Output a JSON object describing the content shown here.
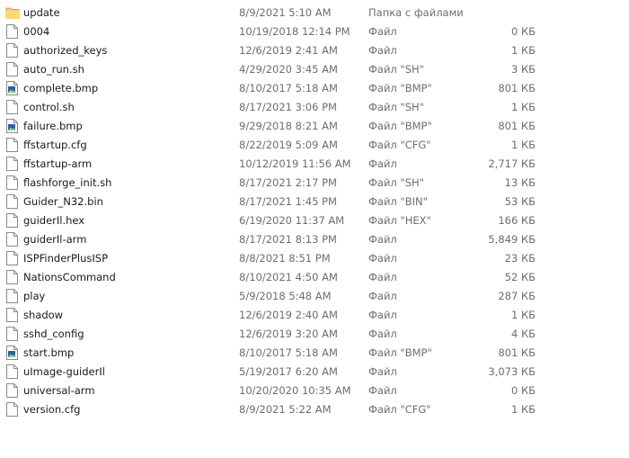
{
  "files": [
    {
      "name": "update",
      "date": "8/9/2021 5:10 AM",
      "type": "Папка с файлами",
      "size": "",
      "icon": "folder-icon"
    },
    {
      "name": "0004",
      "date": "10/19/2018 12:14 PM",
      "type": "Файл",
      "size": "0 КБ",
      "icon": "file-icon"
    },
    {
      "name": "authorized_keys",
      "date": "12/6/2019 2:41 AM",
      "type": "Файл",
      "size": "1 КБ",
      "icon": "file-icon"
    },
    {
      "name": "auto_run.sh",
      "date": "4/29/2020 3:45 AM",
      "type": "Файл \"SH\"",
      "size": "3 КБ",
      "icon": "file-icon"
    },
    {
      "name": "complete.bmp",
      "date": "8/10/2017 5:18 AM",
      "type": "Файл \"BMP\"",
      "size": "801 КБ",
      "icon": "image-file-icon"
    },
    {
      "name": "control.sh",
      "date": "8/17/2021 3:06 PM",
      "type": "Файл \"SH\"",
      "size": "1 КБ",
      "icon": "file-icon"
    },
    {
      "name": "failure.bmp",
      "date": "9/29/2018 8:21 AM",
      "type": "Файл \"BMP\"",
      "size": "801 КБ",
      "icon": "image-file-icon"
    },
    {
      "name": "ffstartup.cfg",
      "date": "8/22/2019 5:09 AM",
      "type": "Файл \"CFG\"",
      "size": "1 КБ",
      "icon": "file-icon"
    },
    {
      "name": "ffstartup-arm",
      "date": "10/12/2019 11:56 AM",
      "type": "Файл",
      "size": "2,717 КБ",
      "icon": "file-icon"
    },
    {
      "name": "flashforge_init.sh",
      "date": "8/17/2021 2:17 PM",
      "type": "Файл \"SH\"",
      "size": "13 КБ",
      "icon": "file-icon"
    },
    {
      "name": "Guider_N32.bin",
      "date": "8/17/2021 1:45 PM",
      "type": "Файл \"BIN\"",
      "size": "53 КБ",
      "icon": "file-icon"
    },
    {
      "name": "guiderIl.hex",
      "date": "6/19/2020 11:37 AM",
      "type": "Файл \"HEX\"",
      "size": "166 КБ",
      "icon": "file-icon"
    },
    {
      "name": "guiderIl-arm",
      "date": "8/17/2021 8:13 PM",
      "type": "Файл",
      "size": "5,849 КБ",
      "icon": "file-icon"
    },
    {
      "name": "ISPFinderPlusISP",
      "date": "8/8/2021 8:51 PM",
      "type": "Файл",
      "size": "23 КБ",
      "icon": "file-icon"
    },
    {
      "name": "NationsCommand",
      "date": "8/10/2021 4:50 AM",
      "type": "Файл",
      "size": "52 КБ",
      "icon": "file-icon"
    },
    {
      "name": "play",
      "date": "5/9/2018 5:48 AM",
      "type": "Файл",
      "size": "287 КБ",
      "icon": "file-icon"
    },
    {
      "name": "shadow",
      "date": "12/6/2019 2:40 AM",
      "type": "Файл",
      "size": "1 КБ",
      "icon": "file-icon"
    },
    {
      "name": "sshd_config",
      "date": "12/6/2019 3:20 AM",
      "type": "Файл",
      "size": "4 КБ",
      "icon": "file-icon"
    },
    {
      "name": "start.bmp",
      "date": "8/10/2017 5:18 AM",
      "type": "Файл \"BMP\"",
      "size": "801 КБ",
      "icon": "image-file-icon"
    },
    {
      "name": "uImage-guiderIl",
      "date": "5/19/2017 6:20 AM",
      "type": "Файл",
      "size": "3,073 КБ",
      "icon": "file-icon"
    },
    {
      "name": "universal-arm",
      "date": "10/20/2020 10:35 AM",
      "type": "Файл",
      "size": "0 КБ",
      "icon": "file-icon"
    },
    {
      "name": "version.cfg",
      "date": "8/9/2021 5:22 AM",
      "type": "Файл \"CFG\"",
      "size": "1 КБ",
      "icon": "file-icon"
    }
  ],
  "colors": {
    "folder": "#e8b94a",
    "file_border": "#8a8a8a",
    "image_accent": "#2b5fa8",
    "secondary_text": "#6d6d6d"
  }
}
